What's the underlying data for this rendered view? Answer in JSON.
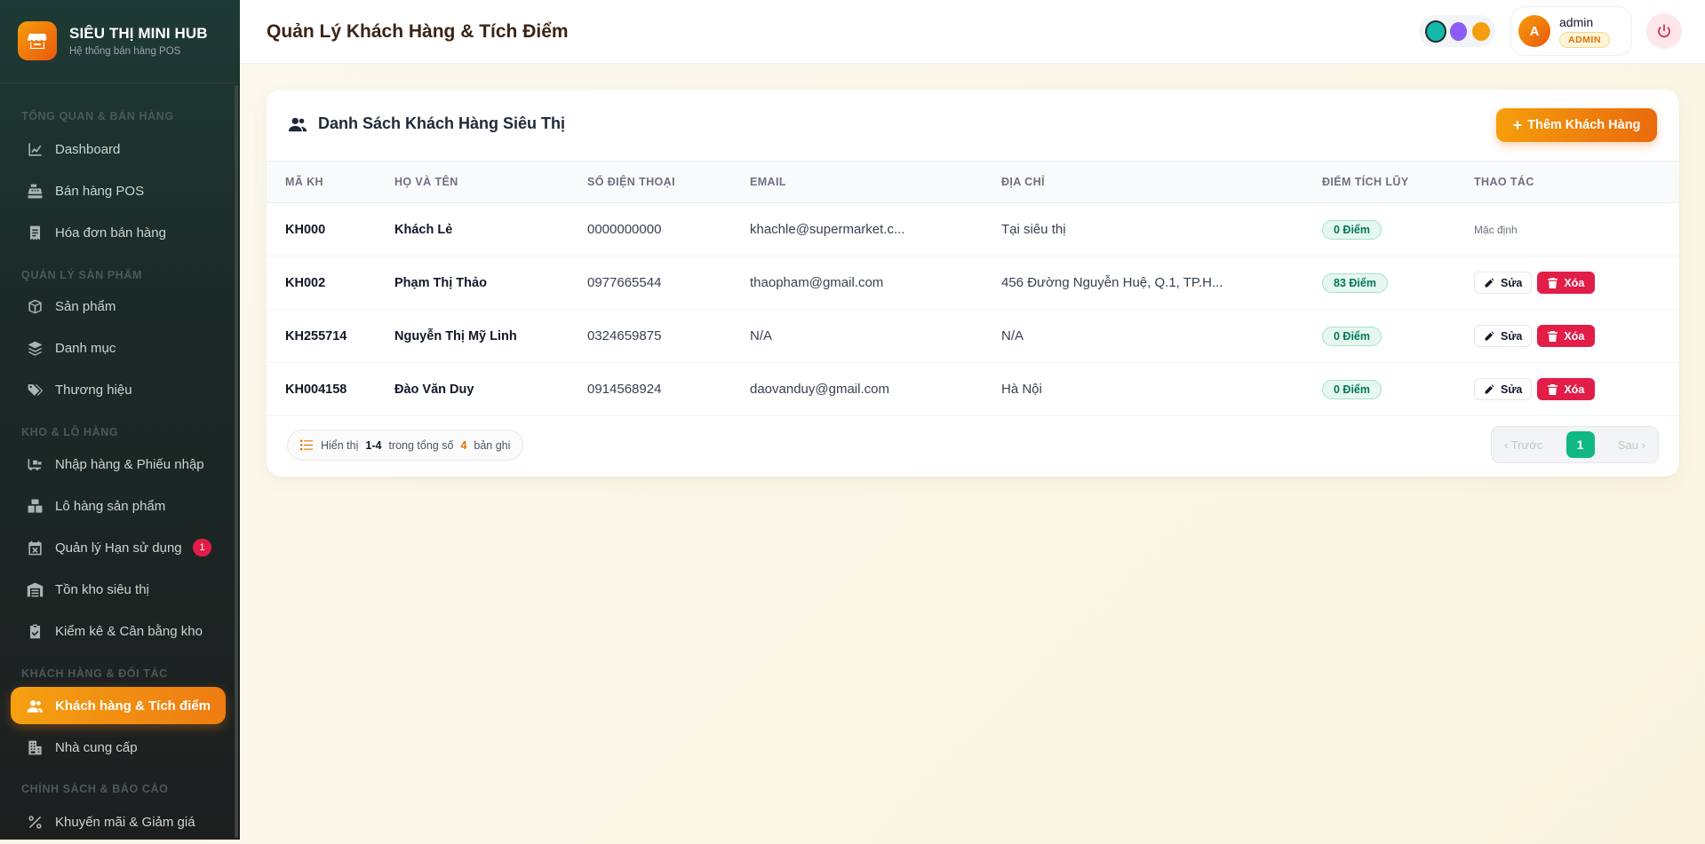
{
  "brand": {
    "name": "SIÊU THỊ MINI HUB",
    "subtitle": "Hệ thống bán hàng POS"
  },
  "sidebar": {
    "sections": [
      {
        "label": "TỔNG QUAN & BÁN HÀNG"
      },
      {
        "label": "QUẢN LÝ SẢN PHẨM"
      },
      {
        "label": "KHO & LÔ HÀNG"
      },
      {
        "label": "KHÁCH HÀNG & ĐỐI TÁC"
      },
      {
        "label": "CHÍNH SÁCH & BÁO CÁO"
      }
    ],
    "items": [
      {
        "label": "Dashboard",
        "icon": "chart-line-icon"
      },
      {
        "label": "Bán hàng POS",
        "icon": "cash-register-icon"
      },
      {
        "label": "Hóa đơn bán hàng",
        "icon": "receipt-icon"
      },
      {
        "label": "Sản phẩm",
        "icon": "box-icon"
      },
      {
        "label": "Danh mục",
        "icon": "layers-icon"
      },
      {
        "label": "Thương hiệu",
        "icon": "tags-icon"
      },
      {
        "label": "Nhập hàng & Phiếu nhập",
        "icon": "truck-loading-icon"
      },
      {
        "label": "Lô hàng sản phẩm",
        "icon": "boxes-icon"
      },
      {
        "label": "Quản lý Hạn sử dụng",
        "icon": "calendar-x-icon",
        "badge": "1"
      },
      {
        "label": "Tồn kho siêu thị",
        "icon": "warehouse-icon"
      },
      {
        "label": "Kiểm kê & Cân bằng kho",
        "icon": "clipboard-check-icon"
      },
      {
        "label": "Khách hàng & Tích điểm",
        "icon": "users-icon",
        "active": true
      },
      {
        "label": "Nhà cung cấp",
        "icon": "building-icon"
      },
      {
        "label": "Khuyến mãi & Giảm giá",
        "icon": "percent-icon"
      }
    ]
  },
  "header": {
    "title": "Quản Lý Khách Hàng & Tích Điểm",
    "themes": [
      "#14b8a6",
      "#8b5cf6",
      "#f59e0b"
    ],
    "user": {
      "initial": "A",
      "name": "admin",
      "role": "ADMIN"
    }
  },
  "card": {
    "title": "Danh Sách Khách Hàng Siêu Thị",
    "add_label": "Thêm Khách Hàng",
    "columns": [
      "MÃ KH",
      "HỌ VÀ TÊN",
      "SỐ ĐIỆN THOẠI",
      "EMAIL",
      "ĐỊA CHỈ",
      "ĐIỂM TÍCH LŨY",
      "THAO TÁC"
    ],
    "rows": [
      {
        "code": "KH000",
        "name": "Khách Lẻ",
        "phone": "0000000000",
        "email": "khachle@supermarket.c...",
        "address": "Tại siêu thị",
        "points": "0 Điểm",
        "action": "Mặc định"
      },
      {
        "code": "KH002",
        "name": "Phạm Thị Thảo",
        "phone": "0977665544",
        "email": "thaopham@gmail.com",
        "address": "456 Đường Nguyễn Huệ, Q.1, TP.H...",
        "points": "83 Điểm"
      },
      {
        "code": "KH255714",
        "name": "Nguyễn Thị Mỹ Linh",
        "phone": "0324659875",
        "email": "N/A",
        "address": "N/A",
        "points": "0 Điểm"
      },
      {
        "code": "KH004158",
        "name": "Đào Văn Duy",
        "phone": "0914568924",
        "email": "daovanduy@gmail.com",
        "address": "Hà Nội",
        "points": "0 Điểm"
      }
    ],
    "edit_label": "Sửa",
    "delete_label": "Xóa",
    "summary": {
      "prefix": "Hiển thị",
      "range": "1-4",
      "middle": "trong tổng số",
      "total": "4",
      "suffix": "bản ghi"
    },
    "pager": {
      "prev": "Trước",
      "page": "1",
      "next": "Sau"
    }
  },
  "colors": {
    "accent": "#f59e0b",
    "success": "#10b981",
    "danger": "#e11d48",
    "sidebar": "#1c2a27"
  }
}
